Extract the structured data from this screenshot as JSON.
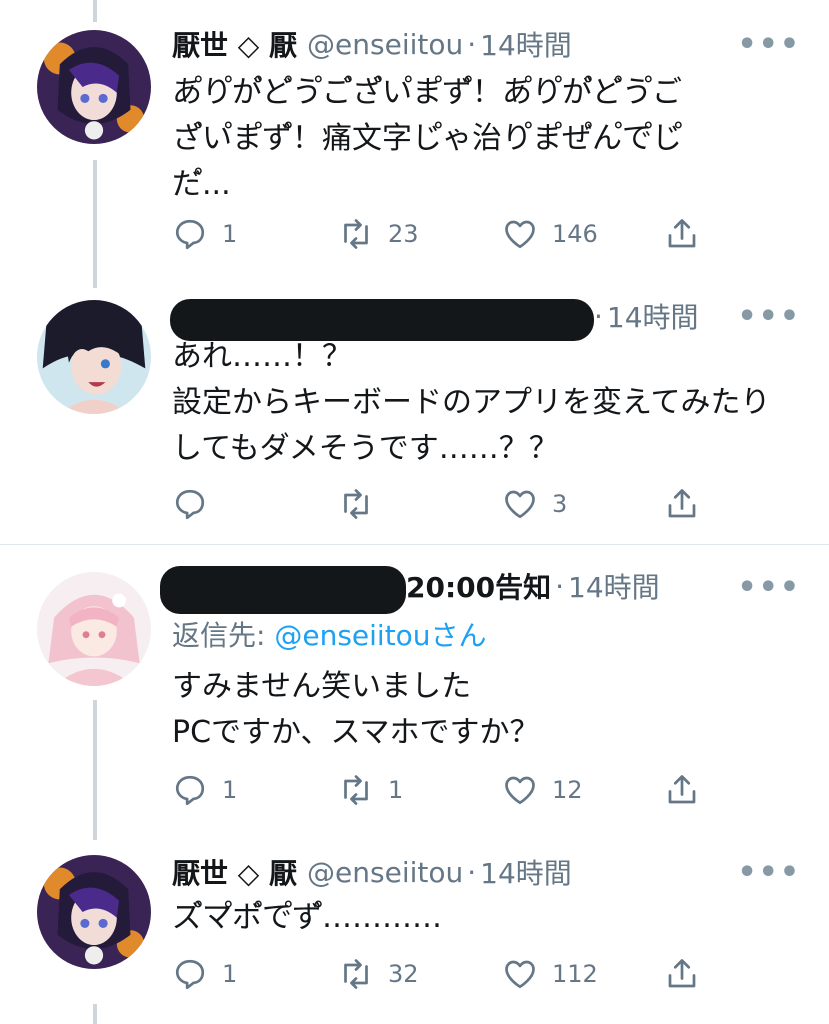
{
  "tweets": [
    {
      "name": "厭世 ◇ 厭",
      "handle": "@enseiitou",
      "dot": "·",
      "time": "14時間",
      "more": "•••",
      "text": [
        "あ゚り゚が゚ど゚う゚ご゚ざ゚い゚ま゚ず゚！あ゚り゚が゚ど゚う゚ご",
        "ざ゚い゚ま゚ず゚！痛文字じ゚ゃ治り゚ま゚ぜ゚ん゚で゚じ゚",
        "だ゚..."
      ],
      "replies": "1",
      "retweets": "23",
      "likes": "146"
    },
    {
      "name": "",
      "dot": "·",
      "time": "14時間",
      "more": "•••",
      "text": [
        "あれ……！？",
        "設定からキーボードのアプリを変えてみたり",
        "してもダメそうです……？？"
      ],
      "replies": "",
      "retweets": "",
      "likes": "3"
    },
    {
      "name_suffix": "20:00告知",
      "dot": "·",
      "time": "14時間",
      "more": "•••",
      "reply_prefix": "返信先: ",
      "reply_handle": "@enseiitouさん",
      "text": [
        "すみません笑いました",
        "PCですか、スマホですか？"
      ],
      "replies": "1",
      "retweets": "1",
      "likes": "12"
    },
    {
      "name": "厭世 ◇ 厭",
      "handle": "@enseiitou",
      "dot": "·",
      "time": "14時間",
      "more": "•••",
      "text": [
        "ズ゚マ゚ボ゚で゚ず゚…………"
      ],
      "replies": "1",
      "retweets": "32",
      "likes": "112"
    }
  ],
  "colors": {
    "accent": "#1da1f2",
    "secondary": "#657786",
    "thread": "#cdd6dd"
  }
}
